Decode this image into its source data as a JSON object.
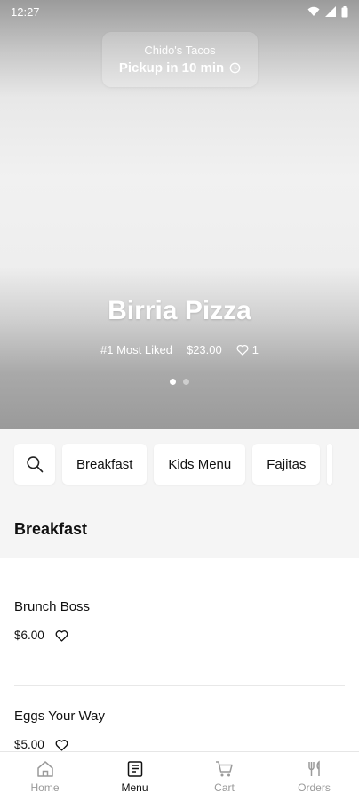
{
  "status_bar": {
    "time": "12:27"
  },
  "pickup": {
    "restaurant": "Chido's Tacos",
    "time_label": "Pickup in 10 min"
  },
  "hero": {
    "title": "Birria Pizza",
    "badge": "#1 Most Liked",
    "price": "$23.00",
    "likes": "1",
    "carousel": {
      "count": 2,
      "active_index": 0
    }
  },
  "categories": [
    "Breakfast",
    "Kids Menu",
    "Fajitas"
  ],
  "section": {
    "title": "Breakfast"
  },
  "menu_items": [
    {
      "name": "Brunch Boss",
      "price": "$6.00"
    },
    {
      "name": "Eggs Your Way",
      "price": "$5.00"
    }
  ],
  "bottom_nav": [
    {
      "label": "Home",
      "icon": "home-icon",
      "active": false
    },
    {
      "label": "Menu",
      "icon": "menu-book-icon",
      "active": true
    },
    {
      "label": "Cart",
      "icon": "cart-icon",
      "active": false
    },
    {
      "label": "Orders",
      "icon": "utensils-icon",
      "active": false
    }
  ]
}
